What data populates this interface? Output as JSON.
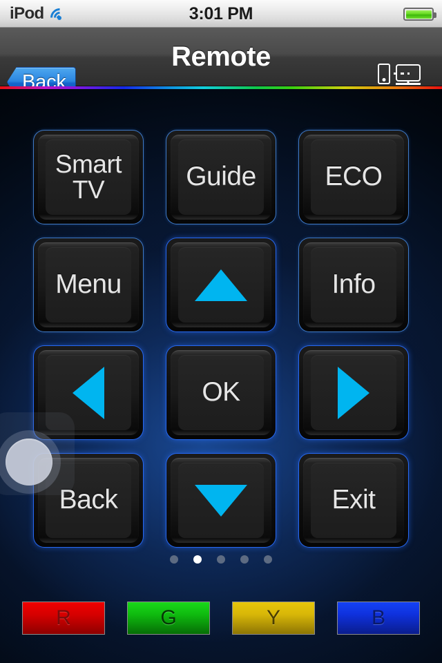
{
  "status_bar": {
    "carrier": "iPod",
    "wifi_icon": "wifi-icon",
    "time": "3:01 PM",
    "battery_icon": "battery-full-icon",
    "battery_level_percent": 100
  },
  "nav_bar": {
    "back_label": "Back",
    "title": "Remote",
    "dlna_label": "DLNA",
    "dlna_icon": "phone-to-monitor-cast-icon"
  },
  "accent_rainbow": [
    "#e81010",
    "#c014c6",
    "#7a18e0",
    "#1528e8",
    "#0f8fe0",
    "#12cfdc",
    "#10c84a",
    "#3ad010",
    "#cfd010",
    "#e88a10",
    "#e81010"
  ],
  "colors": {
    "arrow_blue": "#00b5f0",
    "key_border_blue": "#468ce6",
    "background_blue": "#1a4a96"
  },
  "keypad": {
    "keys": [
      {
        "name": "smart-tv",
        "label": "Smart\nTV",
        "type": "text"
      },
      {
        "name": "guide",
        "label": "Guide",
        "type": "text"
      },
      {
        "name": "eco",
        "label": "ECO",
        "type": "text"
      },
      {
        "name": "menu",
        "label": "Menu",
        "type": "text"
      },
      {
        "name": "up",
        "label": "",
        "type": "arrow-up"
      },
      {
        "name": "info",
        "label": "Info",
        "type": "text"
      },
      {
        "name": "left",
        "label": "",
        "type": "arrow-left"
      },
      {
        "name": "ok",
        "label": "OK",
        "type": "text"
      },
      {
        "name": "right",
        "label": "",
        "type": "arrow-right"
      },
      {
        "name": "back",
        "label": "Back",
        "type": "text"
      },
      {
        "name": "down",
        "label": "",
        "type": "arrow-down"
      },
      {
        "name": "exit",
        "label": "Exit",
        "type": "text"
      }
    ]
  },
  "page_dots": {
    "count": 5,
    "active_index": 1
  },
  "color_buttons": [
    {
      "name": "red",
      "label": "R",
      "color": "#d50000"
    },
    {
      "name": "green",
      "label": "G",
      "color": "#0fbb0f"
    },
    {
      "name": "yellow",
      "label": "Y",
      "color": "#d8b708"
    },
    {
      "name": "blue",
      "label": "B",
      "color": "#0f31dd"
    }
  ],
  "assistive_touch": {
    "name": "assistive-touch-button",
    "label": ""
  }
}
